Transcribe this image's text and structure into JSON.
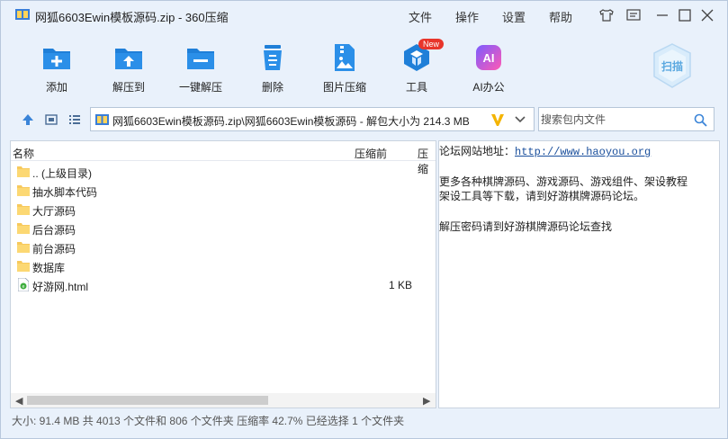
{
  "window": {
    "title": "网狐6603Ewin模板源码.zip - 360压缩",
    "menus": [
      "文件",
      "操作",
      "设置",
      "帮助"
    ]
  },
  "toolbar": {
    "items": [
      {
        "label": "添加",
        "icon": "add-icon"
      },
      {
        "label": "解压到",
        "icon": "extract-to-icon"
      },
      {
        "label": "一键解压",
        "icon": "one-click-extract-icon"
      },
      {
        "label": "删除",
        "icon": "delete-icon"
      },
      {
        "label": "图片压缩",
        "icon": "image-compress-icon"
      },
      {
        "label": "工具",
        "icon": "tools-icon",
        "badge": "New"
      },
      {
        "label": "AI办公",
        "icon": "ai-office-icon",
        "icon_text": "AI"
      }
    ],
    "scan_label": "扫描"
  },
  "address": {
    "path": "网狐6603Ewin模板源码.zip\\网狐6603Ewin模板源码 - 解包大小为 214.3 MB",
    "search_placeholder": "搜索包内文件"
  },
  "file_list": {
    "columns": [
      "名称",
      "压缩前",
      "压缩"
    ],
    "rows": [
      {
        "name": ".. (上级目录)",
        "size": "",
        "type": "folder"
      },
      {
        "name": "抽水脚本代码",
        "size": "",
        "type": "folder"
      },
      {
        "name": "大厅源码",
        "size": "",
        "type": "folder"
      },
      {
        "name": "后台源码",
        "size": "",
        "type": "folder"
      },
      {
        "name": "前台源码",
        "size": "",
        "type": "folder"
      },
      {
        "name": "数据库",
        "size": "",
        "type": "folder"
      },
      {
        "name": "好游网.html",
        "size": "1 KB",
        "type": "html"
      }
    ]
  },
  "comment": {
    "site_label": "论坛网站地址：",
    "site_url": "http://www.haoyou.org",
    "line2": "更多各种棋牌源码、游戏源码、游戏组件、架设教程",
    "line3": "架设工具等下载，请到好游棋牌源码论坛。",
    "line4": "解压密码请到好游棋牌源码论坛查找"
  },
  "status": {
    "text": "大小: 91.4 MB 共 4013 个文件和 806 个文件夹 压缩率 42.7% 已经选择 1 个文件夹"
  },
  "colors": {
    "accent": "#1f7fd8",
    "window_bg": "#e9f1fb",
    "badge_red": "#e8352b",
    "v_yellow": "#f4b400"
  }
}
